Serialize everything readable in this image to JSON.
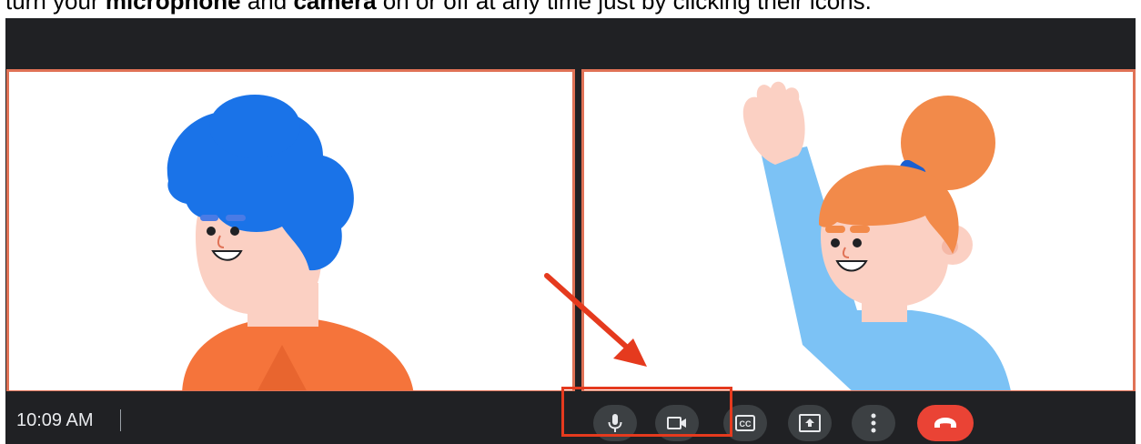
{
  "caption": {
    "part1": "turn your ",
    "bold1": "microphone",
    "part2": " and ",
    "bold2": "camera",
    "part3": " on or off at any time just by clicking their icons."
  },
  "status": {
    "time": "10:09 AM"
  },
  "controls": {
    "mic_icon": "microphone-icon",
    "camera_icon": "videocam-icon",
    "captions_label": "CC",
    "present_icon": "present-screen-icon",
    "more_icon": "more-options-icon",
    "end_call_icon": "end-call-icon"
  },
  "colors": {
    "window_bg": "#202124",
    "control_btn": "#3c4043",
    "end_call": "#ea4335",
    "tile_border": "#e07256",
    "highlight": "#e53a1e"
  }
}
